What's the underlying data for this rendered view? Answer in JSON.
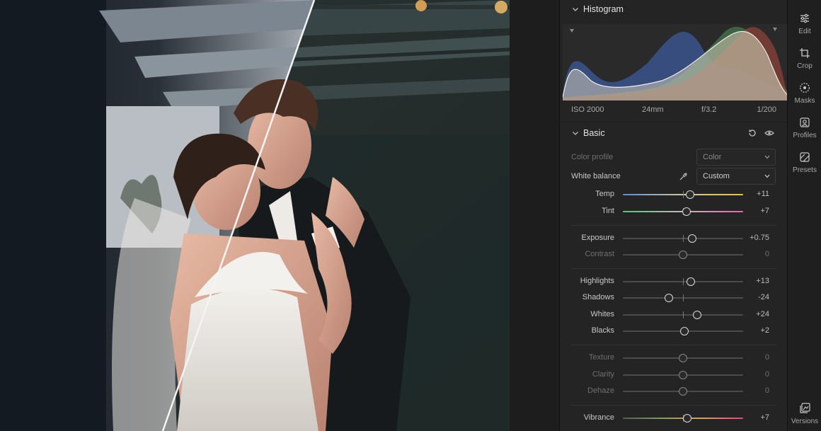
{
  "histogram": {
    "title": "Histogram",
    "iso": "ISO 2000",
    "focal": "24mm",
    "aperture": "f/3.2",
    "shutter": "1/200"
  },
  "basic": {
    "title": "Basic",
    "color_profile": {
      "label": "Color profile",
      "value": "Color"
    },
    "white_balance": {
      "label": "White balance",
      "value": "Custom"
    }
  },
  "sliders": {
    "temp": {
      "label": "Temp",
      "value": "+11",
      "level": 0.56
    },
    "tint": {
      "label": "Tint",
      "value": "+7",
      "level": 0.53
    },
    "exposure": {
      "label": "Exposure",
      "value": "+0.75",
      "level": 0.575
    },
    "contrast": {
      "label": "Contrast",
      "value": "0",
      "level": 0.5
    },
    "highlights": {
      "label": "Highlights",
      "value": "+13",
      "level": 0.565
    },
    "shadows": {
      "label": "Shadows",
      "value": "-24",
      "level": 0.38
    },
    "whites": {
      "label": "Whites",
      "value": "+24",
      "level": 0.62
    },
    "blacks": {
      "label": "Blacks",
      "value": "+2",
      "level": 0.51
    },
    "texture": {
      "label": "Texture",
      "value": "0",
      "level": 0.5
    },
    "clarity": {
      "label": "Clarity",
      "value": "0",
      "level": 0.5
    },
    "dehaze": {
      "label": "Dehaze",
      "value": "0",
      "level": 0.5
    },
    "vibrance": {
      "label": "Vibrance",
      "value": "+7",
      "level": 0.535
    }
  },
  "tools": {
    "edit": "Edit",
    "crop": "Crop",
    "masks": "Masks",
    "profiles": "Profiles",
    "presets": "Presets",
    "versions": "Versions"
  },
  "colors": {
    "panel_bg": "#242424",
    "histogram_blue": "#3b5a9a",
    "histogram_green": "#4f8a54",
    "histogram_red": "#a34a3e"
  }
}
